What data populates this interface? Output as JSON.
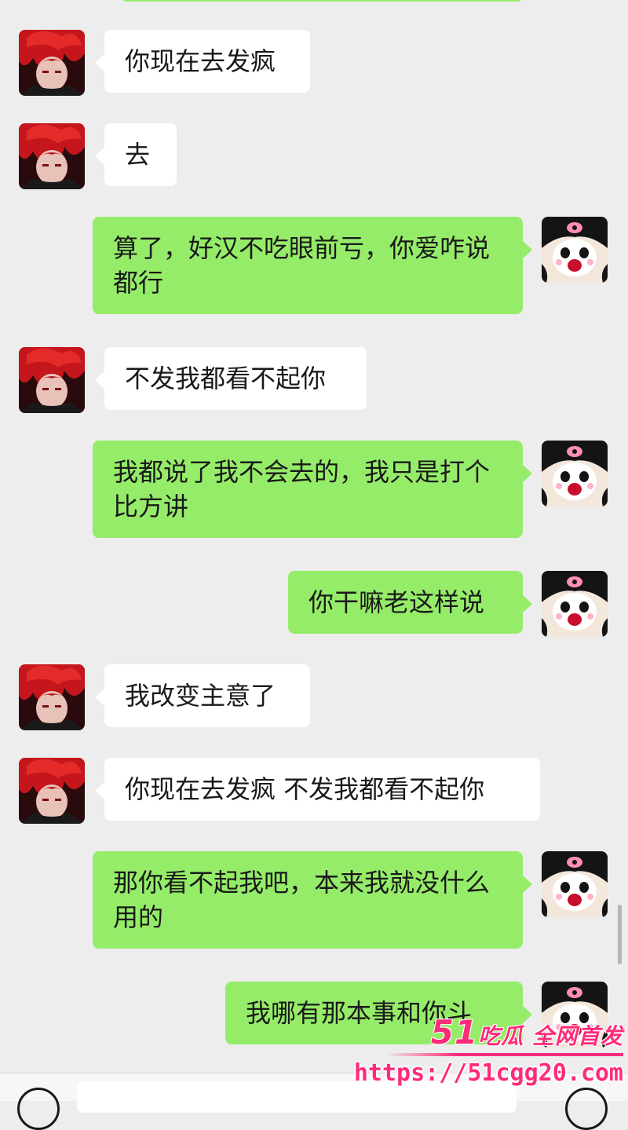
{
  "messages": [
    {
      "side": "in",
      "text": "你现在去发疯"
    },
    {
      "side": "in",
      "text": "去"
    },
    {
      "side": "out",
      "text": "算了，好汉不吃眼前亏，你爱咋说都行"
    },
    {
      "side": "in",
      "text": "不发我都看不起你"
    },
    {
      "side": "out",
      "text": "我都说了我不会去的，我只是打个比方讲"
    },
    {
      "side": "out",
      "text": "你干嘛老这样说"
    },
    {
      "side": "in",
      "text": "我改变主意了"
    },
    {
      "side": "in",
      "text": "你现在去发疯 不发我都看不起你"
    },
    {
      "side": "out",
      "text": "那你看不起我吧，本来我就没什么用的"
    },
    {
      "side": "out",
      "text": "我哪有那本事和你斗"
    }
  ],
  "avatars": {
    "in": "red-hair-anime-avatar",
    "out": "panda-cartoon-avatar"
  },
  "watermark": {
    "number": "51",
    "text": "吃瓜 全网首发",
    "url": "https://51cgg20.com"
  },
  "colors": {
    "background": "#ededed",
    "outgoing_bubble": "#95ec69",
    "incoming_bubble": "#ffffff",
    "watermark": "#ff2b7a"
  }
}
